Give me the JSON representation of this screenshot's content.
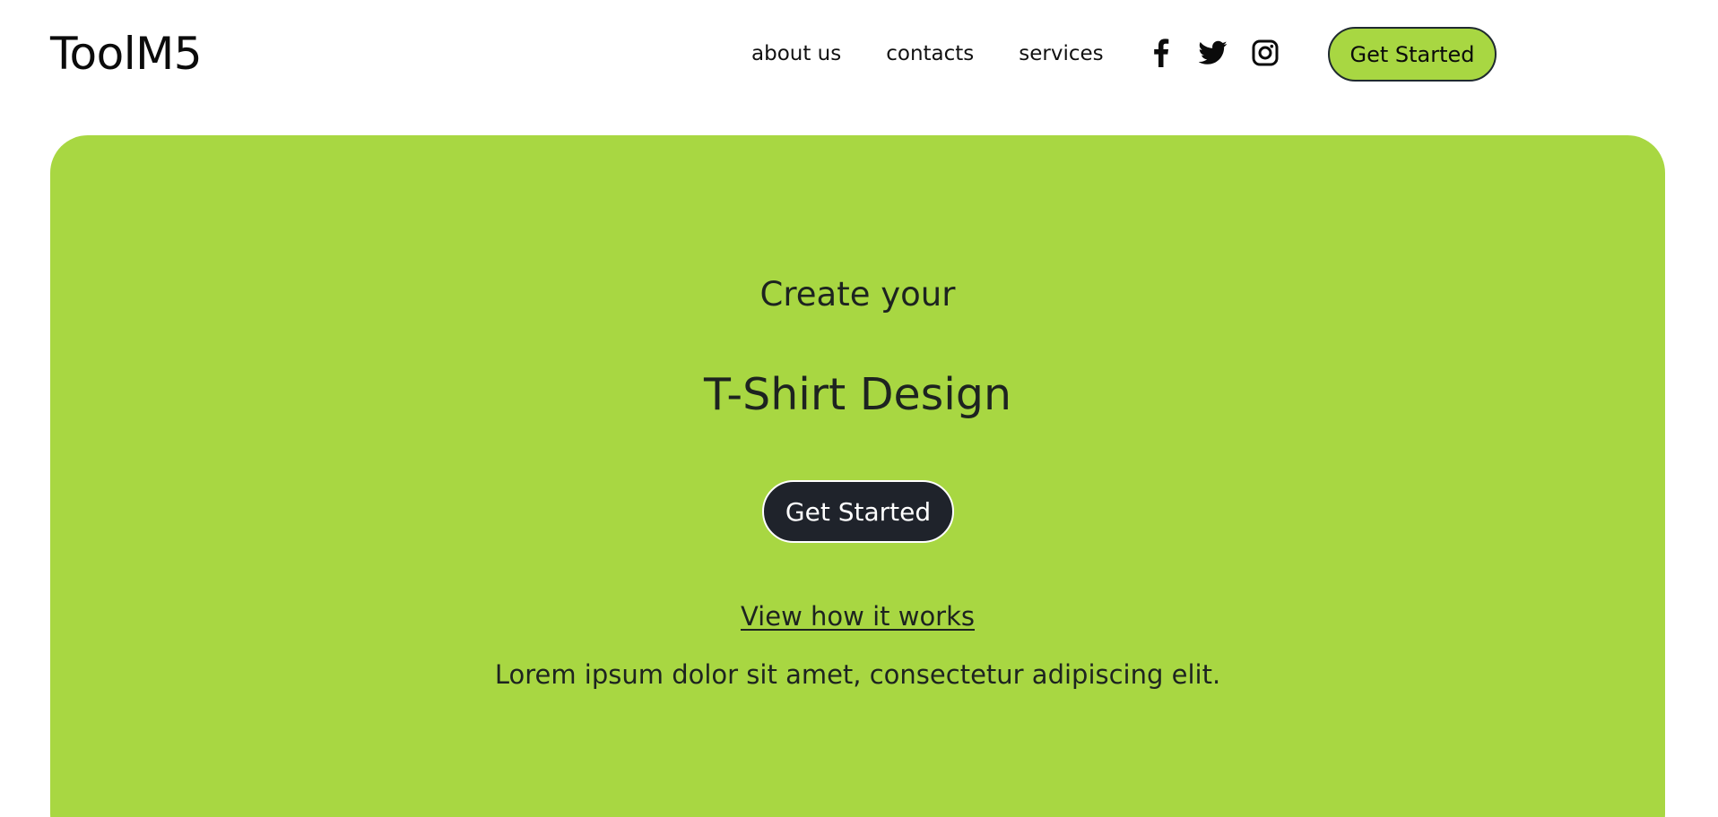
{
  "header": {
    "logo": "ToolM5",
    "nav": [
      {
        "label": "about us"
      },
      {
        "label": "contacts"
      },
      {
        "label": "services"
      }
    ],
    "social": [
      {
        "icon": "facebook-icon"
      },
      {
        "icon": "twitter-icon"
      },
      {
        "icon": "instagram-icon"
      }
    ],
    "cta_label": "Get Started"
  },
  "hero": {
    "kicker": "Create your",
    "title": "T-Shirt Design",
    "cta_label": "Get Started",
    "link_label": "View how it works",
    "description": "Lorem ipsum dolor sit amet, consectetur adipiscing elit."
  },
  "colors": {
    "accent": "#a8d742",
    "dark_button": "#1f232b",
    "text": "#1d2320",
    "background": "#ffffff"
  }
}
